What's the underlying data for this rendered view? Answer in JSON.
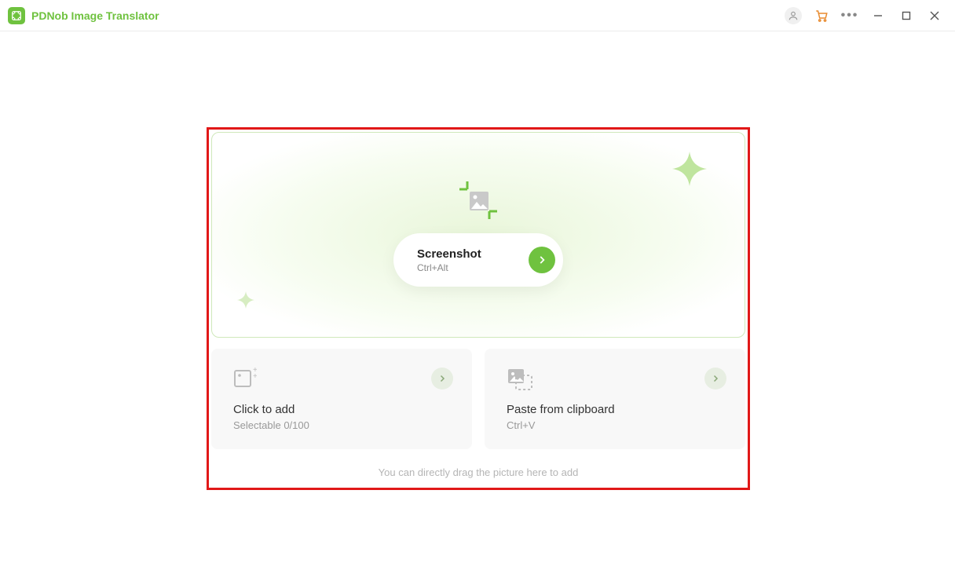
{
  "app": {
    "title": "PDNob Image Translator"
  },
  "hero": {
    "title": "Screenshot",
    "shortcut": "Ctrl+Alt"
  },
  "click_to_add": {
    "title": "Click to add",
    "sub": "Selectable 0/100"
  },
  "paste": {
    "title": "Paste from clipboard",
    "shortcut": "Ctrl+V"
  },
  "drag_hint": "You can directly drag the picture here to add"
}
